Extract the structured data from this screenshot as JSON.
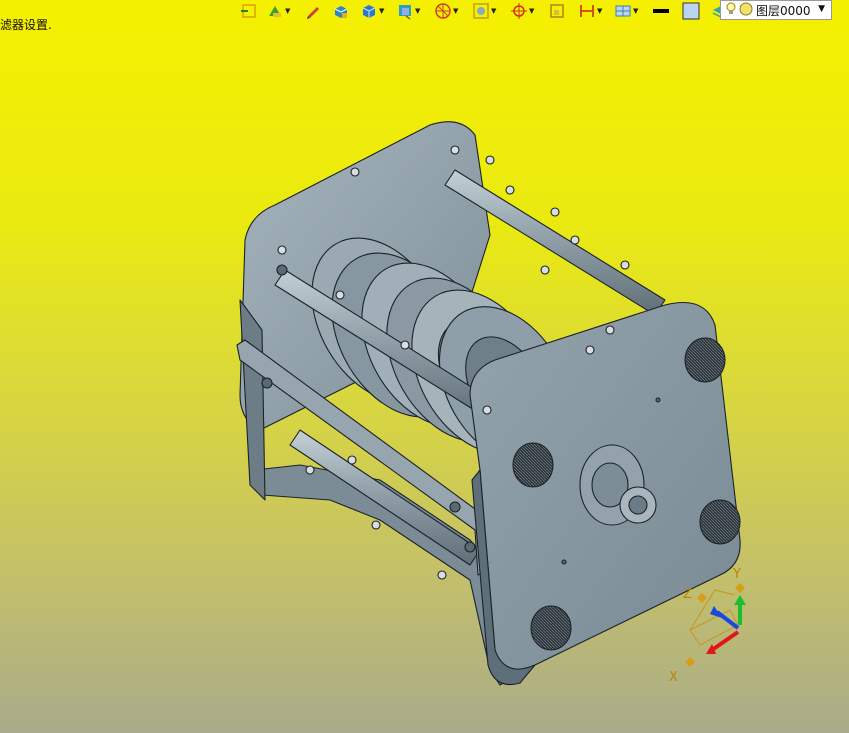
{
  "status": {
    "text": "滤器设置."
  },
  "toolbar": {
    "buttons": [
      {
        "name": "open-part-icon",
        "has_dropdown": false,
        "color": "#d9a400"
      },
      {
        "name": "sketch-tools-icon",
        "has_dropdown": true,
        "color": "#3aa030"
      },
      {
        "name": "pencil-icon",
        "has_dropdown": false,
        "color": "#d04040"
      },
      {
        "name": "shaded-box-icon",
        "has_dropdown": false,
        "color": "#2f86c6"
      },
      {
        "name": "render-style-icon",
        "has_dropdown": true,
        "color": "#2b79c9"
      },
      {
        "name": "view-orient-icon",
        "has_dropdown": true,
        "color": "#2aa0c8"
      },
      {
        "name": "wireframe-sphere-icon",
        "has_dropdown": true,
        "color": "#d04030"
      },
      {
        "name": "snap-frame-icon",
        "has_dropdown": true,
        "color": "#c89a20"
      },
      {
        "name": "crosshair-icon",
        "has_dropdown": true,
        "color": "#d03020"
      },
      {
        "name": "frame-box-icon",
        "has_dropdown": false,
        "color": "#b08020"
      },
      {
        "name": "section-icon",
        "has_dropdown": true,
        "color": "#d04020"
      },
      {
        "name": "display-grid-icon",
        "has_dropdown": true,
        "color": "#3a7fc0"
      },
      {
        "name": "line-color-icon",
        "has_dropdown": false,
        "color": "#000000"
      },
      {
        "name": "fill-color-icon",
        "has_dropdown": false,
        "color": "#bcd4f0"
      },
      {
        "name": "layers-icon",
        "has_dropdown": true,
        "color": "#36a0b0"
      }
    ]
  },
  "layer": {
    "value": "图层0000"
  },
  "triad": {
    "x_label": "X",
    "y_label": "Y",
    "z_label": "Z"
  },
  "colors": {
    "part_fill": "#8a9aa4",
    "part_light": "#a9b7bf",
    "part_dark": "#5e6e78",
    "edge": "#1b2228"
  }
}
